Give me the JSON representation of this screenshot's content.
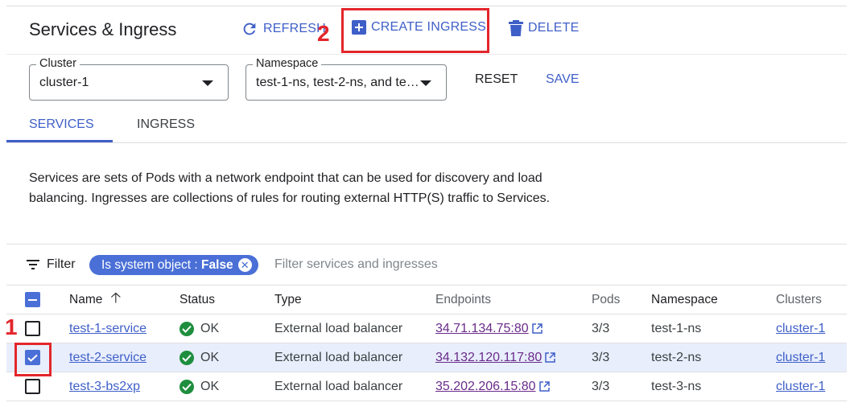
{
  "header": {
    "title": "Services & Ingress",
    "refresh_label": "REFRESH",
    "create_label": "CREATE INGRESS",
    "delete_label": "DELETE"
  },
  "annotations": {
    "marker_1": "1",
    "marker_2": "2",
    "marker_color": "#e3262b"
  },
  "filters": {
    "cluster": {
      "label": "Cluster",
      "value": "cluster-1"
    },
    "namespace": {
      "label": "Namespace",
      "value": "test-1-ns, test-2-ns, and te…"
    },
    "reset_label": "RESET",
    "save_label": "SAVE"
  },
  "tabs": [
    {
      "label": "SERVICES",
      "active": true
    },
    {
      "label": "INGRESS",
      "active": false
    }
  ],
  "description": "Services are sets of Pods with a network endpoint that can be used for discovery and load balancing. Ingresses are collections of rules for routing external HTTP(S) traffic to Services.",
  "filter_bar": {
    "label": "Filter",
    "chip_key": "Is system object : ",
    "chip_value": "False",
    "placeholder": "Filter services and ingresses"
  },
  "table": {
    "headers": {
      "name": "Name",
      "status": "Status",
      "type": "Type",
      "endpoints": "Endpoints",
      "pods": "Pods",
      "namespace": "Namespace",
      "clusters": "Clusters"
    },
    "rows": [
      {
        "checked": false,
        "name": "test-1-service",
        "status": "OK",
        "type": "External load balancer",
        "endpoint": "34.71.134.75:80",
        "pods": "3/3",
        "namespace": "test-1-ns",
        "cluster": "cluster-1"
      },
      {
        "checked": true,
        "name": "test-2-service",
        "status": "OK",
        "type": "External load balancer",
        "endpoint": "34.132.120.117:80",
        "pods": "3/3",
        "namespace": "test-2-ns",
        "cluster": "cluster-1"
      },
      {
        "checked": false,
        "name": "test-3-bs2xp",
        "status": "OK",
        "type": "External load balancer",
        "endpoint": "35.202.206.15:80",
        "pods": "3/3",
        "namespace": "test-3-ns",
        "cluster": "cluster-1"
      }
    ]
  },
  "colors": {
    "accent": "#3f5fc8",
    "chip": "#4a6fd6",
    "ok": "#1e8e3e",
    "selected_row": "#e8eefc"
  }
}
